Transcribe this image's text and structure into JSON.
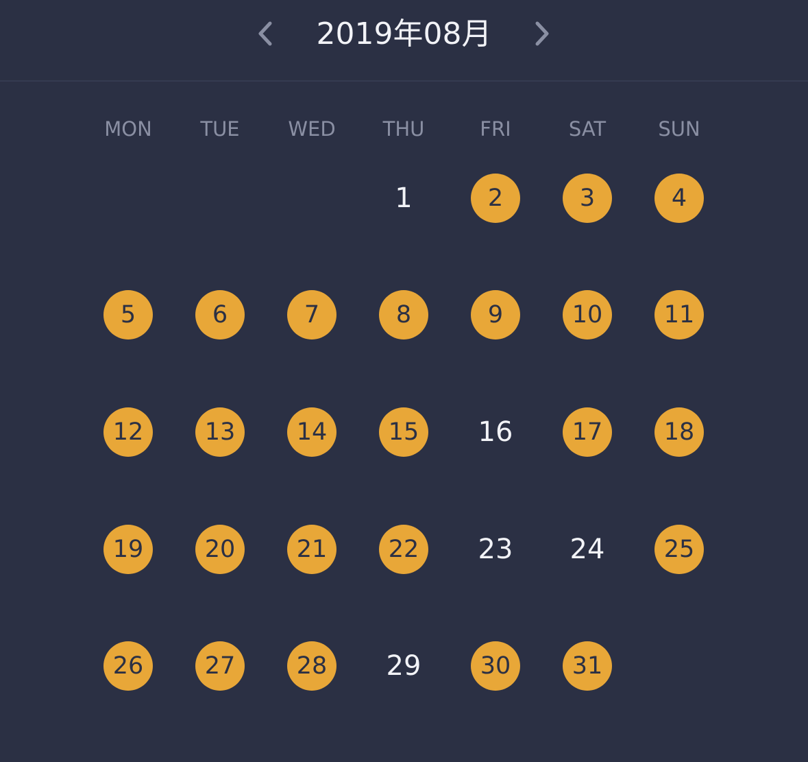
{
  "header": {
    "title": "2019年08月",
    "prev_icon": "chevron-left-icon",
    "next_icon": "chevron-right-icon"
  },
  "weekdays": [
    "MON",
    "TUE",
    "WED",
    "THU",
    "FRI",
    "SAT",
    "SUN"
  ],
  "calendar": {
    "first_weekday_index": 3,
    "days_in_month": 31,
    "marked_days": [
      2,
      3,
      4,
      5,
      6,
      7,
      8,
      9,
      10,
      11,
      12,
      13,
      14,
      15,
      17,
      18,
      19,
      20,
      21,
      22,
      25,
      26,
      27,
      28,
      30,
      31
    ]
  },
  "colors": {
    "background": "#2b3044",
    "marked": "#e8a738",
    "marked_text": "#2b3044",
    "plain_text": "#f2f3f7",
    "weekday_text": "#8a8fa3"
  }
}
